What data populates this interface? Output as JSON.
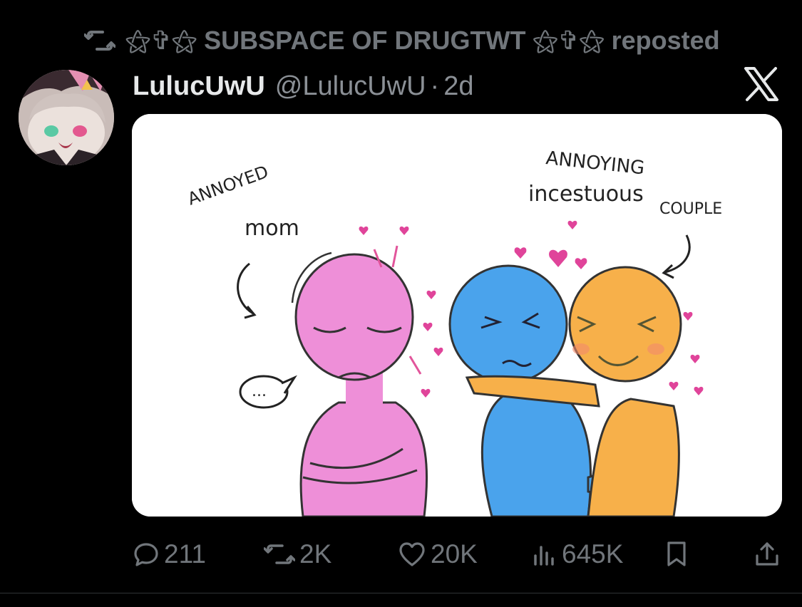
{
  "repost": {
    "icon": "repost-icon",
    "text": "⚝✞⚝ SUBSPACE OF DRUGTWT ⚝✞⚝ reposted"
  },
  "post": {
    "display_name": "LulucUwU",
    "handle": "@LulucUwU",
    "separator": "·",
    "time": "2d",
    "platform_icon": "x-logo-icon"
  },
  "media": {
    "label_mom_1": "ANNOYED",
    "label_mom_2": "mom",
    "label_couple_1": "ANNOYING",
    "label_couple_2": "incestuous",
    "label_couple_3": "COUPLE",
    "speech_bubble": "..."
  },
  "actions": {
    "replies": "211",
    "reposts": "2K",
    "likes": "20K",
    "views": "645K"
  },
  "colors": {
    "background": "#000000",
    "text_primary": "#e7e9ea",
    "text_secondary": "#71767b",
    "pink_figure": "#ee8fd8",
    "blue_figure": "#4aa3ec",
    "orange_figure": "#f7b04a",
    "heart": "#e0449a"
  }
}
